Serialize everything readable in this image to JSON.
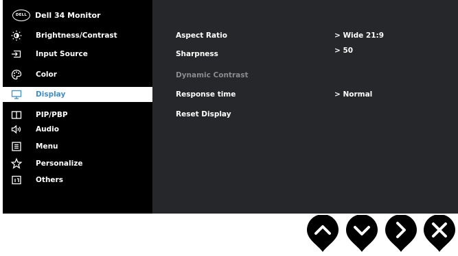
{
  "header": {
    "logo_text": "DELL",
    "title": "Dell 34 Monitor"
  },
  "menu": {
    "items": [
      {
        "label": "Brightness/Contrast",
        "icon": "brightness-icon"
      },
      {
        "label": "Input Source",
        "icon": "input-source-icon"
      },
      {
        "label": "Color",
        "icon": "palette-icon"
      },
      {
        "label": "Display",
        "icon": "monitor-icon",
        "selected": true
      },
      {
        "label": "PIP/PBP",
        "icon": "pip-icon"
      },
      {
        "label": "Audio",
        "icon": "speaker-icon"
      },
      {
        "label": "Menu",
        "icon": "menu-list-icon"
      },
      {
        "label": "Personalize",
        "icon": "star-icon"
      },
      {
        "label": "Others",
        "icon": "info-icon"
      }
    ]
  },
  "display_settings": {
    "aspect_ratio": {
      "label": "Aspect Ratio",
      "value": "> Wide 21:9"
    },
    "sharpness": {
      "label": "Sharpness",
      "value": "> 50"
    },
    "dynamic_contrast": {
      "label": "Dynamic Contrast",
      "disabled": true
    },
    "response_time": {
      "label": "Response time",
      "value": "> Normal"
    },
    "reset_display": {
      "label": "Reset Display"
    }
  },
  "nav_buttons": [
    {
      "name": "up-button",
      "icon": "chevron-up-icon"
    },
    {
      "name": "down-button",
      "icon": "chevron-down-icon"
    },
    {
      "name": "right-button",
      "icon": "chevron-right-icon"
    },
    {
      "name": "exit-button",
      "icon": "close-icon"
    }
  ],
  "colors": {
    "osd_background": "#26272a",
    "sidebar_background": "#000000",
    "selected_background": "#ffffff",
    "selected_text": "#3a8fd6",
    "disabled_text": "#8a8b8e"
  }
}
